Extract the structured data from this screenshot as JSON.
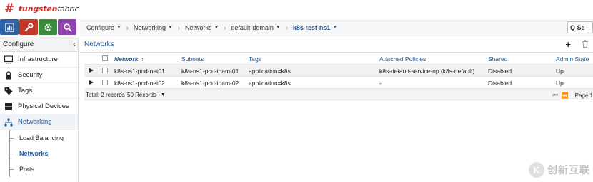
{
  "app": {
    "logo_glyph": "#",
    "logo_brand": "tungsten",
    "logo_product": "fabric"
  },
  "topnav": {
    "icons": [
      "monitor-icon",
      "wrench-icon",
      "gear-icon",
      "search-icon"
    ]
  },
  "breadcrumb": [
    {
      "label": "Configure",
      "has_caret": true
    },
    {
      "label": "Networking",
      "has_caret": true
    },
    {
      "label": "Networks",
      "has_caret": true
    },
    {
      "label": "default-domain",
      "has_caret": true
    },
    {
      "label": "k8s-test-ns1",
      "has_caret": true,
      "active": true
    }
  ],
  "search": {
    "label": "Q Se"
  },
  "sidebar": {
    "title": "Configure",
    "items": [
      {
        "label": "Infrastructure",
        "icon": "monitor-icon"
      },
      {
        "label": "Security",
        "icon": "lock-icon"
      },
      {
        "label": "Tags",
        "icon": "tag-icon"
      },
      {
        "label": "Physical Devices",
        "icon": "server-icon"
      },
      {
        "label": "Networking",
        "icon": "network-icon",
        "open": true
      }
    ],
    "subitems": [
      {
        "label": "Load Balancing"
      },
      {
        "label": "Networks",
        "selected": true
      },
      {
        "label": "Ports"
      }
    ]
  },
  "panel": {
    "title": "Networks",
    "add_label": "+"
  },
  "table": {
    "headers": {
      "network": "Network",
      "sort_glyph": "↑",
      "subnets": "Subnets",
      "tags": "Tags",
      "policies": "Attached Policies",
      "shared": "Shared",
      "admin_state": "Admin State"
    },
    "rows": [
      {
        "network": "k8s-ns1-pod-net01",
        "subnets": "k8s-ns1-pod-ipam-01",
        "tags": "application=k8s",
        "policies": "k8s-default-service-np (k8s-default)",
        "shared": "Disabled",
        "admin_state": "Up"
      },
      {
        "network": "k8s-ns1-pod-net02",
        "subnets": "k8s-ns1-pod-ipam-02",
        "tags": "application=k8s",
        "policies": "-",
        "shared": "Disabled",
        "admin_state": "Up"
      }
    ]
  },
  "footer": {
    "total": "Total: 2 records",
    "per_page": "50 Records",
    "page_label": "Page 1"
  },
  "watermark": {
    "glyph": "K",
    "text": "创新互联"
  },
  "colors": {
    "accent": "#1f5a9a",
    "monitor": "#2e62a8",
    "configure": "#c0392b",
    "settings": "#3a8b3c",
    "query": "#8e44ad",
    "brand": "#c8312c"
  }
}
